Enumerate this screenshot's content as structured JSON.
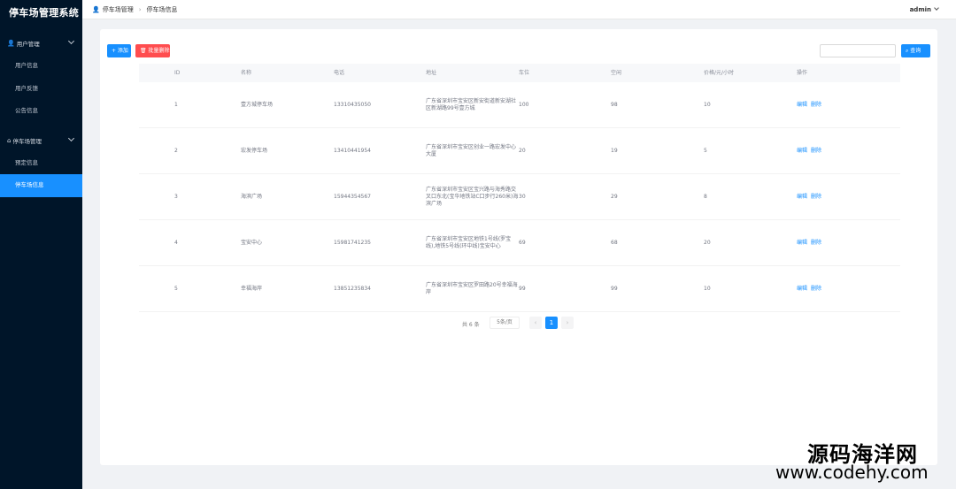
{
  "app": {
    "title": "停车场管理系统"
  },
  "sidebar": {
    "groups": [
      {
        "label": "用户管理",
        "items": [
          "用户信息",
          "用户反馈",
          "公告信息"
        ]
      },
      {
        "label": "停车场管理",
        "items": [
          "预定信息",
          "停车场信息"
        ]
      }
    ],
    "active_item": "停车场信息"
  },
  "header": {
    "breadcrumb": [
      "停车场管理",
      "停车场信息"
    ],
    "user": "admin"
  },
  "toolbar": {
    "add_label": "+ 添加",
    "batch_delete_label": "批量删除",
    "search_placeholder": "",
    "search_label": "查询"
  },
  "table": {
    "columns": [
      "ID",
      "名称",
      "电话",
      "地址",
      "车位",
      "空闲",
      "价格/元/小时",
      "操作"
    ],
    "rows": [
      {
        "id": "1",
        "name": "壹方城停车场",
        "phone": "13310435050",
        "address": "广东省深圳市宝安区新安街道新安湖社区新湖路99号壹方城",
        "spaces": "100",
        "free": "98",
        "price": "10"
      },
      {
        "id": "2",
        "name": "宏发停车场",
        "phone": "13410441954",
        "address": "广东省深圳市宝安区创业一路宏发中心大厦",
        "spaces": "20",
        "free": "19",
        "price": "5"
      },
      {
        "id": "3",
        "name": "海滨广场",
        "phone": "15944354567",
        "address": "广东省深圳市宝安区宝兴路与海秀路交叉口东北(宝华地铁站C口步行260米)海滨广场",
        "spaces": "30",
        "free": "29",
        "price": "8"
      },
      {
        "id": "4",
        "name": "宝安中心",
        "phone": "15981741235",
        "address": "广东省深圳市宝安区地铁1号线(罗宝线),地铁5号线(环中线)宝安中心",
        "spaces": "69",
        "free": "68",
        "price": "20"
      },
      {
        "id": "5",
        "name": "幸福海岸",
        "phone": "13851235834",
        "address": "广东省深圳市宝安区罗田路20号幸福海岸",
        "spaces": "99",
        "free": "99",
        "price": "10"
      }
    ],
    "actions": {
      "edit": "编辑",
      "delete": "删除"
    }
  },
  "pagination": {
    "total": "共 6 条",
    "page_size": "5条/页",
    "current_page": "1",
    "prev": "‹",
    "next": "›"
  },
  "watermark": {
    "line1": "源码海洋网",
    "line2": "www.codehy.com"
  },
  "colors": {
    "sidebar_bg": "#001529",
    "primary": "#1890ff",
    "danger": "#ff4d4f"
  }
}
